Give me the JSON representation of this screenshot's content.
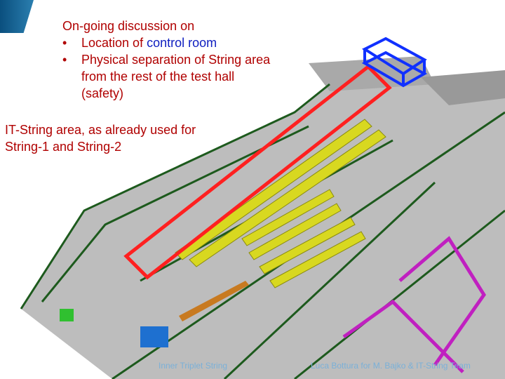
{
  "header": {
    "intro": "On-going discussion on",
    "bullets": [
      {
        "prefix": "Location of ",
        "highlight": "control room"
      },
      {
        "text_line1": "Physical separation of String area",
        "text_line2": "from the rest of the test hall",
        "text_line3": "(safety)"
      }
    ]
  },
  "annotation": {
    "line1": "IT-String area, as already used for",
    "line2": "String-1 and String-2"
  },
  "footer": {
    "left": "Inner Triplet String",
    "right": "Luca Bottura for M. Bajko & IT-String Team"
  },
  "colors": {
    "text_red": "#b00000",
    "highlight_blue": "#1020c0",
    "area_outline": "#ff2020",
    "control_room": "#1030ff"
  }
}
